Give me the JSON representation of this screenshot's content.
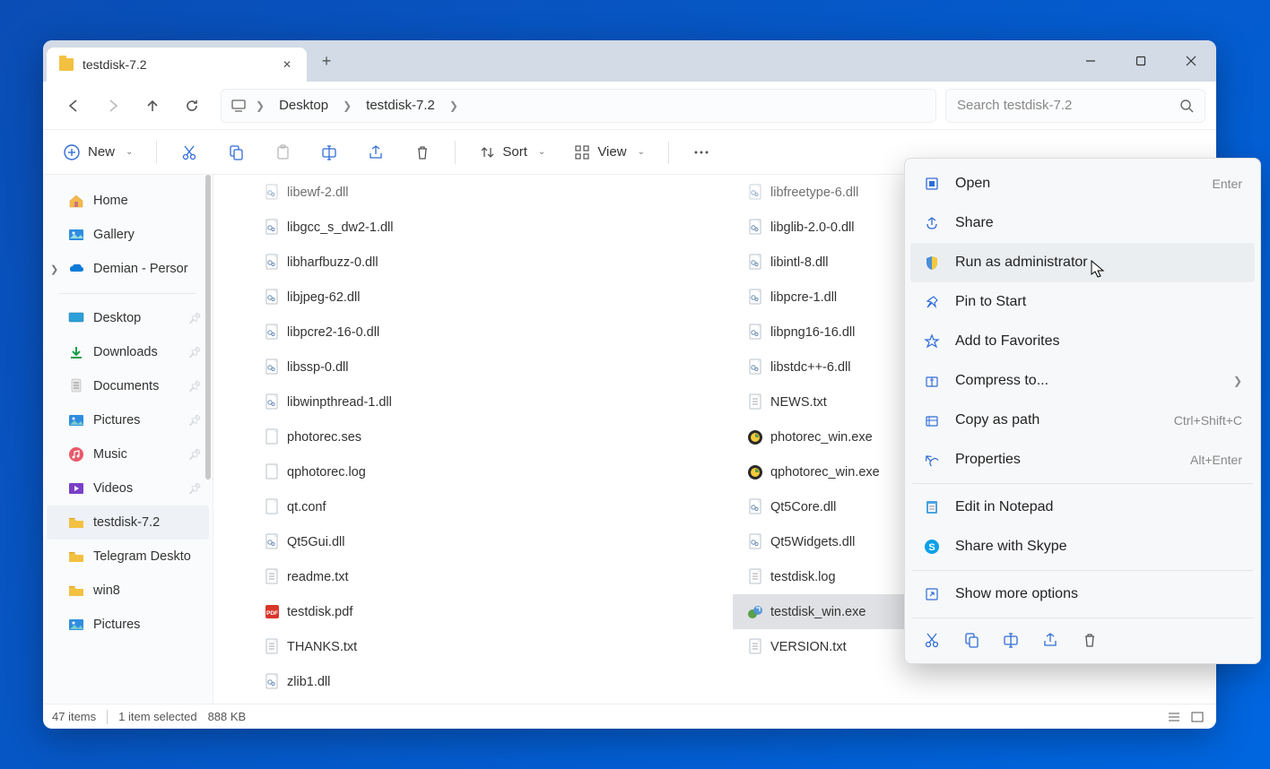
{
  "tab": {
    "title": "testdisk-7.2"
  },
  "breadcrumb": {
    "items": [
      "Desktop",
      "testdisk-7.2"
    ]
  },
  "search": {
    "placeholder": "Search testdisk-7.2"
  },
  "toolbar": {
    "new": "New",
    "sort": "Sort",
    "view": "View"
  },
  "sidebar": {
    "top": [
      {
        "label": "Home",
        "icon": "home"
      },
      {
        "label": "Gallery",
        "icon": "gallery"
      },
      {
        "label": "Demian - Persor",
        "icon": "onedrive",
        "expandable": true
      }
    ],
    "pinned": [
      {
        "label": "Desktop",
        "icon": "desktop"
      },
      {
        "label": "Downloads",
        "icon": "download"
      },
      {
        "label": "Documents",
        "icon": "document"
      },
      {
        "label": "Pictures",
        "icon": "picture"
      },
      {
        "label": "Music",
        "icon": "music"
      },
      {
        "label": "Videos",
        "icon": "video"
      },
      {
        "label": "testdisk-7.2",
        "icon": "folder",
        "selected": true
      },
      {
        "label": "Telegram Deskto",
        "icon": "folder"
      },
      {
        "label": "win8",
        "icon": "folder"
      },
      {
        "label": "Pictures",
        "icon": "picture2"
      }
    ]
  },
  "files": {
    "col1": [
      {
        "name": "libewf-2.dll",
        "type": "dll",
        "cut": true
      },
      {
        "name": "libgcc_s_dw2-1.dll",
        "type": "dll"
      },
      {
        "name": "libharfbuzz-0.dll",
        "type": "dll"
      },
      {
        "name": "libjpeg-62.dll",
        "type": "dll"
      },
      {
        "name": "libpcre2-16-0.dll",
        "type": "dll"
      },
      {
        "name": "libssp-0.dll",
        "type": "dll"
      },
      {
        "name": "libwinpthread-1.dll",
        "type": "dll"
      },
      {
        "name": "photorec.ses",
        "type": "file"
      },
      {
        "name": "qphotorec.log",
        "type": "file"
      },
      {
        "name": "qt.conf",
        "type": "file"
      },
      {
        "name": "Qt5Gui.dll",
        "type": "dll"
      },
      {
        "name": "readme.txt",
        "type": "txt"
      },
      {
        "name": "testdisk.pdf",
        "type": "pdf"
      },
      {
        "name": "THANKS.txt",
        "type": "txt"
      },
      {
        "name": "zlib1.dll",
        "type": "dll"
      }
    ],
    "col2": [
      {
        "name": "libfreetype-6.dll",
        "type": "dll",
        "cut": true
      },
      {
        "name": "libglib-2.0-0.dll",
        "type": "dll"
      },
      {
        "name": "libintl-8.dll",
        "type": "dll"
      },
      {
        "name": "libpcre-1.dll",
        "type": "dll"
      },
      {
        "name": "libpng16-16.dll",
        "type": "dll"
      },
      {
        "name": "libstdc++-6.dll",
        "type": "dll"
      },
      {
        "name": "NEWS.txt",
        "type": "txt"
      },
      {
        "name": "photorec_win.exe",
        "type": "exe-pr"
      },
      {
        "name": "qphotorec_win.exe",
        "type": "exe-pr"
      },
      {
        "name": "Qt5Core.dll",
        "type": "dll"
      },
      {
        "name": "Qt5Widgets.dll",
        "type": "dll"
      },
      {
        "name": "testdisk.log",
        "type": "txt"
      },
      {
        "name": "testdisk_win.exe",
        "type": "exe-td",
        "selected": true
      },
      {
        "name": "VERSION.txt",
        "type": "txt"
      }
    ]
  },
  "context_menu": [
    {
      "label": "Open",
      "icon": "open",
      "shortcut": "Enter"
    },
    {
      "label": "Share",
      "icon": "share"
    },
    {
      "label": "Run as administrator",
      "icon": "shield",
      "hover": true
    },
    {
      "label": "Pin to Start",
      "icon": "pin"
    },
    {
      "label": "Add to Favorites",
      "icon": "star"
    },
    {
      "label": "Compress to...",
      "icon": "compress",
      "submenu": true
    },
    {
      "label": "Copy as path",
      "icon": "copypath",
      "shortcut": "Ctrl+Shift+C"
    },
    {
      "label": "Properties",
      "icon": "props",
      "shortcut": "Alt+Enter"
    },
    {
      "sep": true
    },
    {
      "label": "Edit in Notepad",
      "icon": "notepad"
    },
    {
      "label": "Share with Skype",
      "icon": "skype"
    },
    {
      "sep": true
    },
    {
      "label": "Show more options",
      "icon": "more"
    }
  ],
  "statusbar": {
    "count": "47 items",
    "selected": "1 item selected",
    "size": "888 KB"
  }
}
